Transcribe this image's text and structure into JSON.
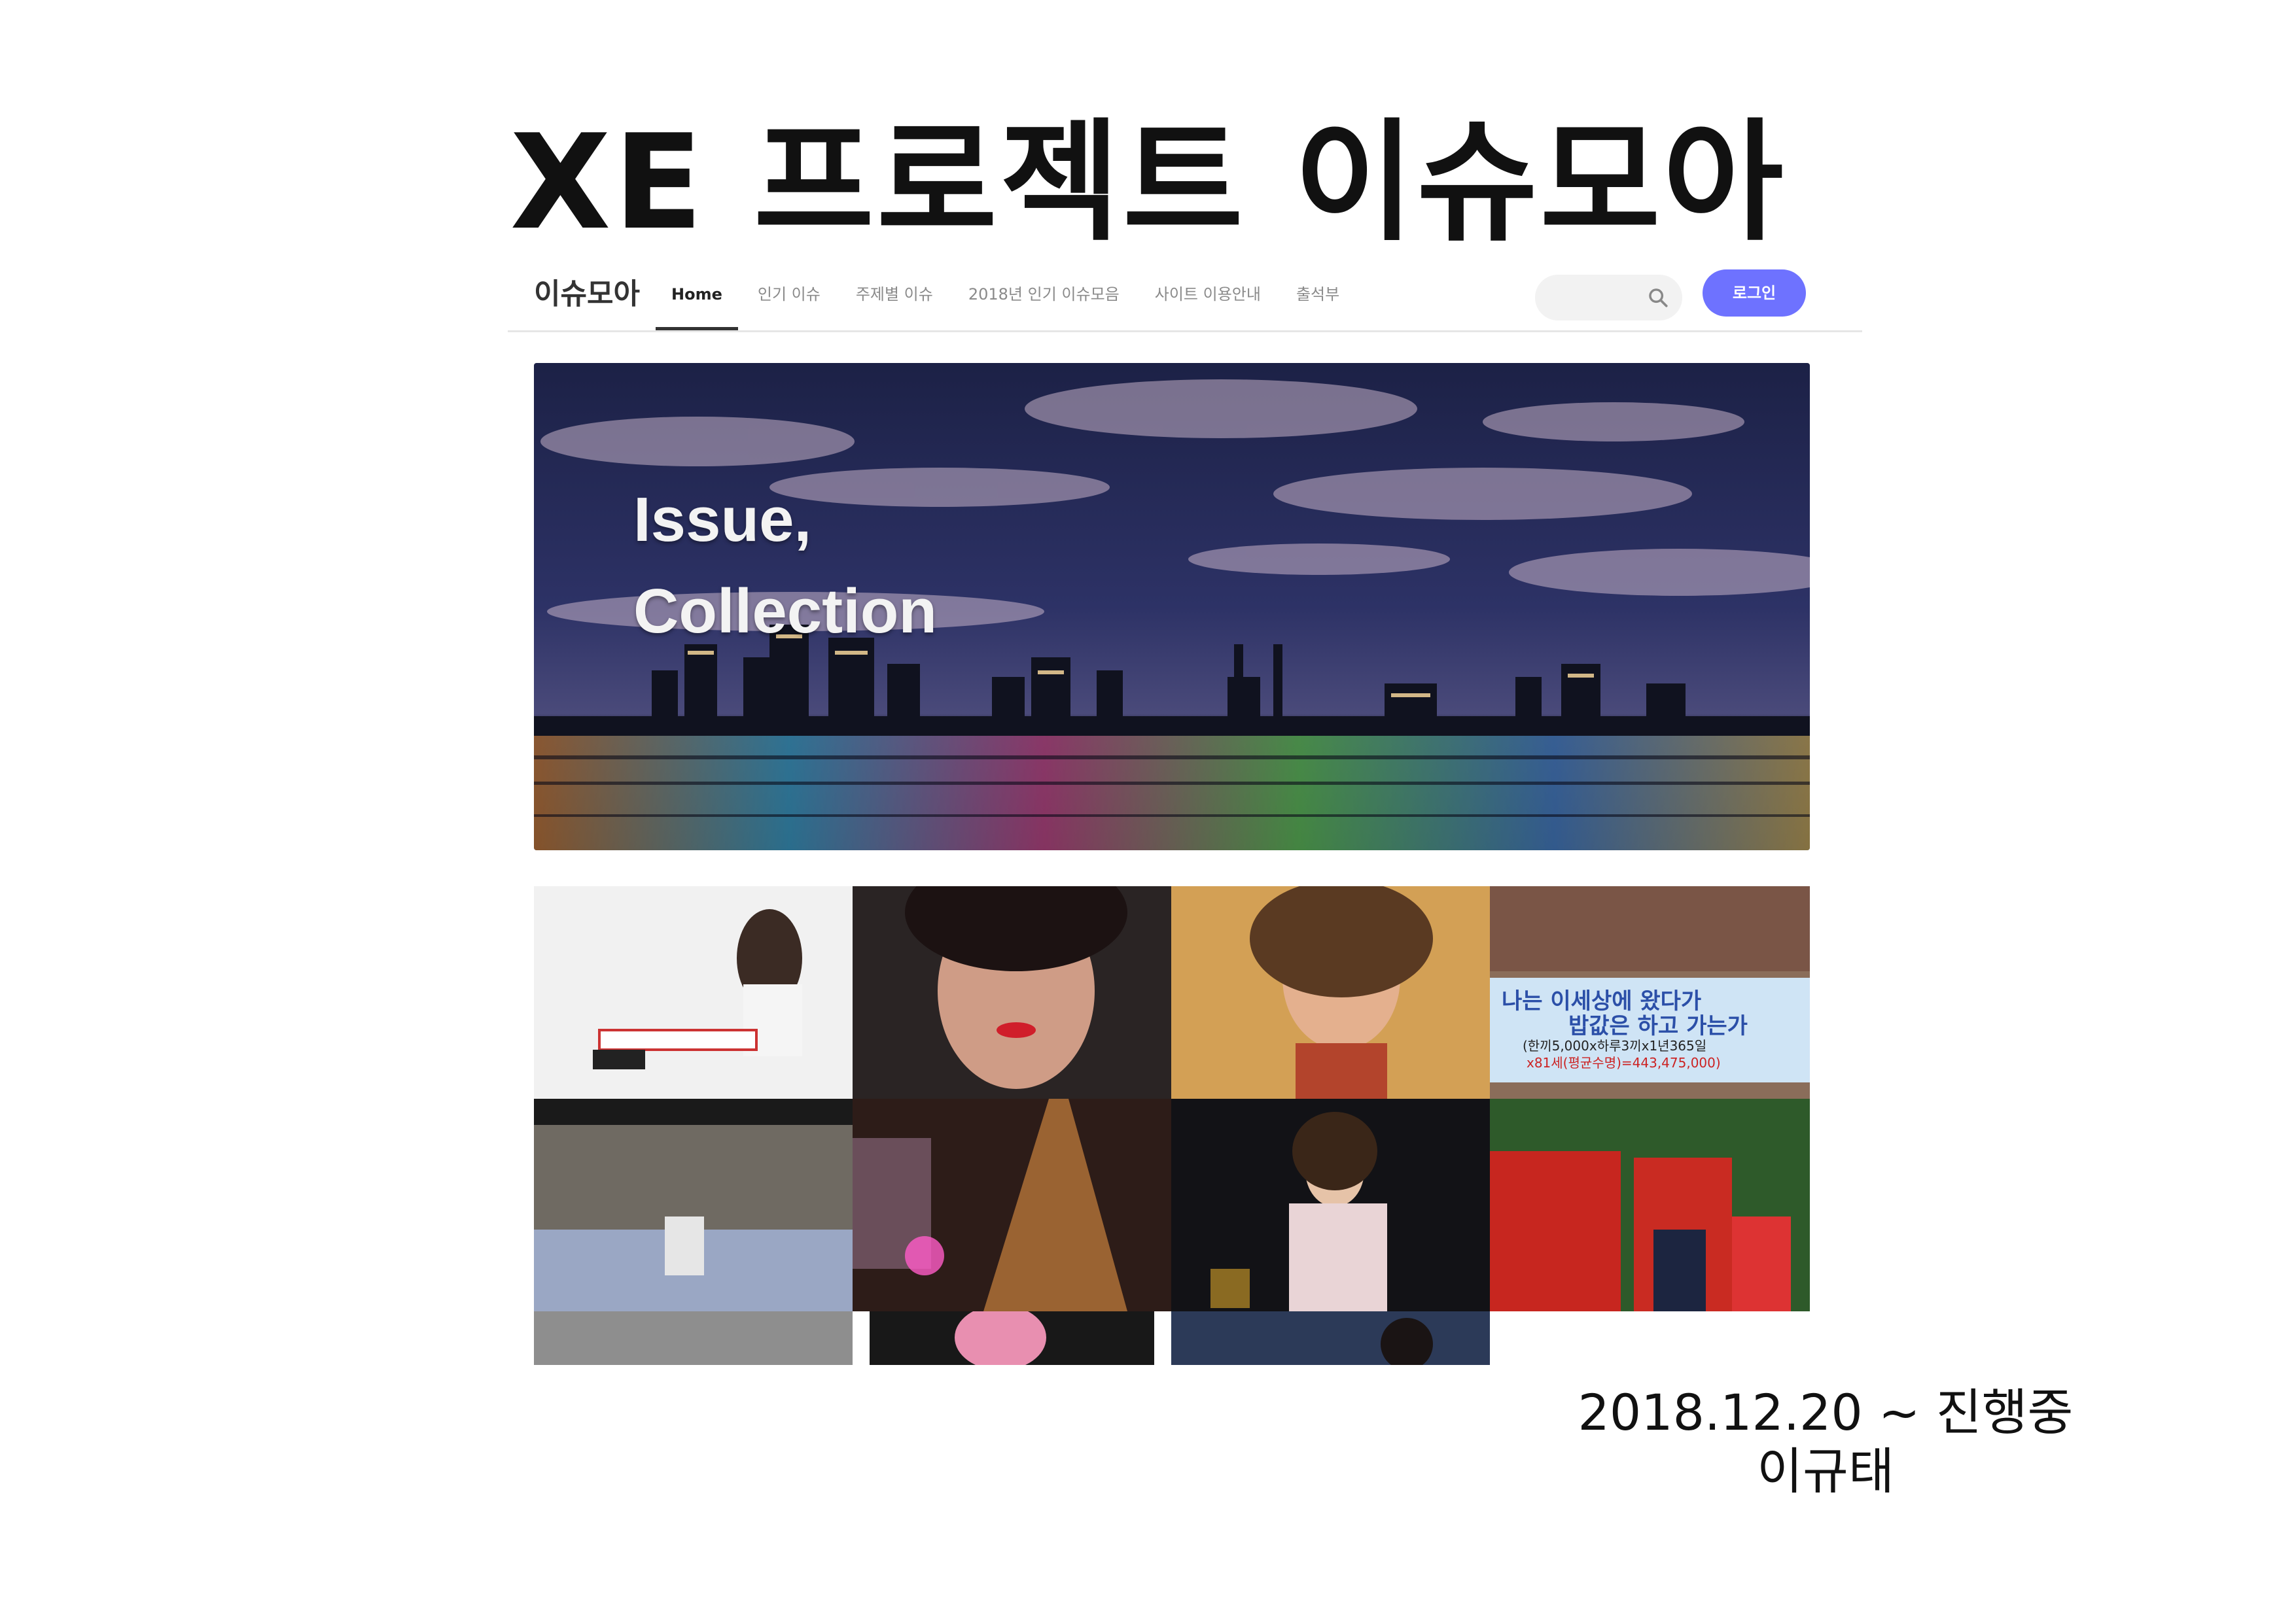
{
  "slide": {
    "title": "XE 프로젝트 이슈모아",
    "date": "2018.12.20 ~ 진행중",
    "author": "이규태"
  },
  "site": {
    "brand": "이슈모아",
    "menu": [
      "Home",
      "인기 이슈",
      "주제별 이슈",
      "2018년 인기 이슈모음",
      "사이트 이용안내",
      "출석부"
    ],
    "active_menu": "Home",
    "search": {
      "placeholder": "",
      "icon": "search-icon"
    },
    "login_label": "로그인",
    "accent_color": "#6e72ff"
  },
  "hero": {
    "line1": "Issue,",
    "line2": "Collection"
  },
  "gallery": {
    "banner_text_line1": "나는 이세상에 왔다가",
    "banner_text_line2": "밥값은 하고 가는가",
    "banner_text_line3": "(한끼5,000x하루3끼x1년365일",
    "banner_text_line4": "x81세(평균수명)=443,475,000)",
    "tile_colors": [
      "#ececec",
      "#3a3030",
      "#c89a55",
      "#7a8a9a",
      "#5d5d5f",
      "#3a2a24",
      "#1b1b1e",
      "#c0302a",
      "#8a8a8a",
      "#1a1a1a",
      "#3a4a66"
    ]
  }
}
